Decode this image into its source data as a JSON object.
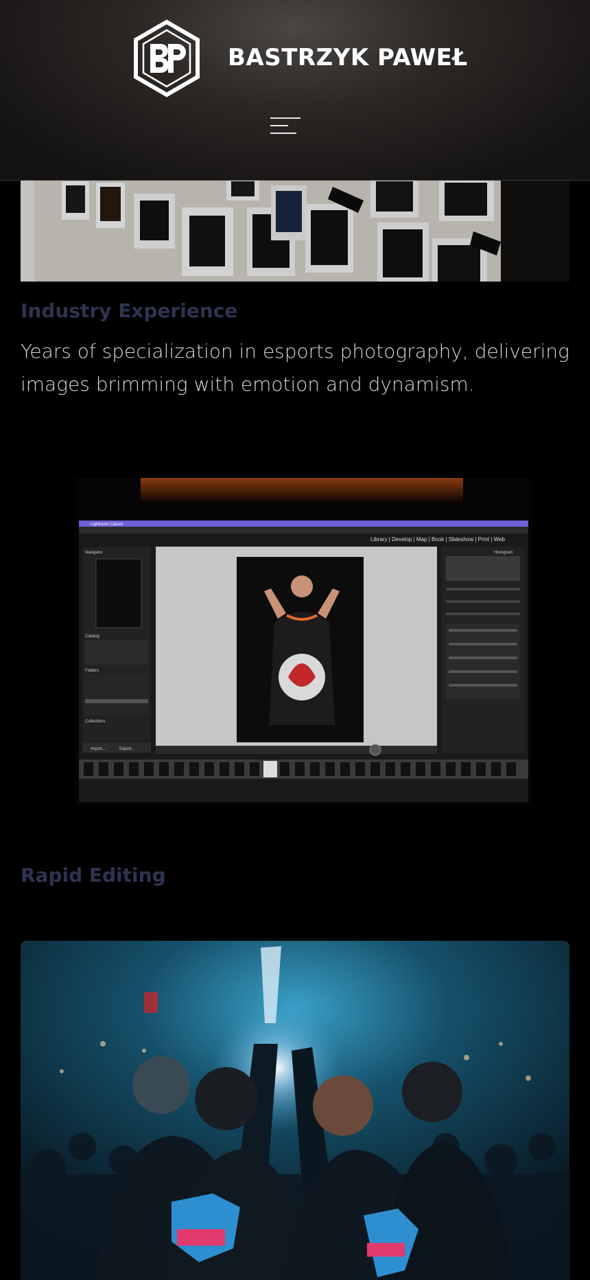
{
  "header": {
    "logo_letters": "BP",
    "brand_name": "BASTRZYK PAWEŁ",
    "menu_icon": "hamburger-menu-icon"
  },
  "sections": [
    {
      "heading": "Industry Experience",
      "text": "Years of specialization in esports photography, delivering images brimming with emotion and dynamism."
    },
    {
      "heading": "Rapid Editing"
    }
  ],
  "images": {
    "wall_photos": "photo-wall-image",
    "editing_screen": "lightroom-editing-image",
    "trophy_celebration": "trophy-celebration-image"
  },
  "lightroom": {
    "app_menu": "Lightroom Classic",
    "modules": "Library | Develop | Map | Book | Slideshow | Print | Web",
    "panel_navigator": "Navigator",
    "panel_catalog": "Catalog",
    "panel_folders": "Folders",
    "panel_collections": "Collections",
    "panel_histogram": "Histogram",
    "import_btn": "Import...",
    "export_btn": "Export..."
  },
  "colors": {
    "heading": "#2f3350",
    "text": "#d9d9d9",
    "background": "#000000"
  }
}
